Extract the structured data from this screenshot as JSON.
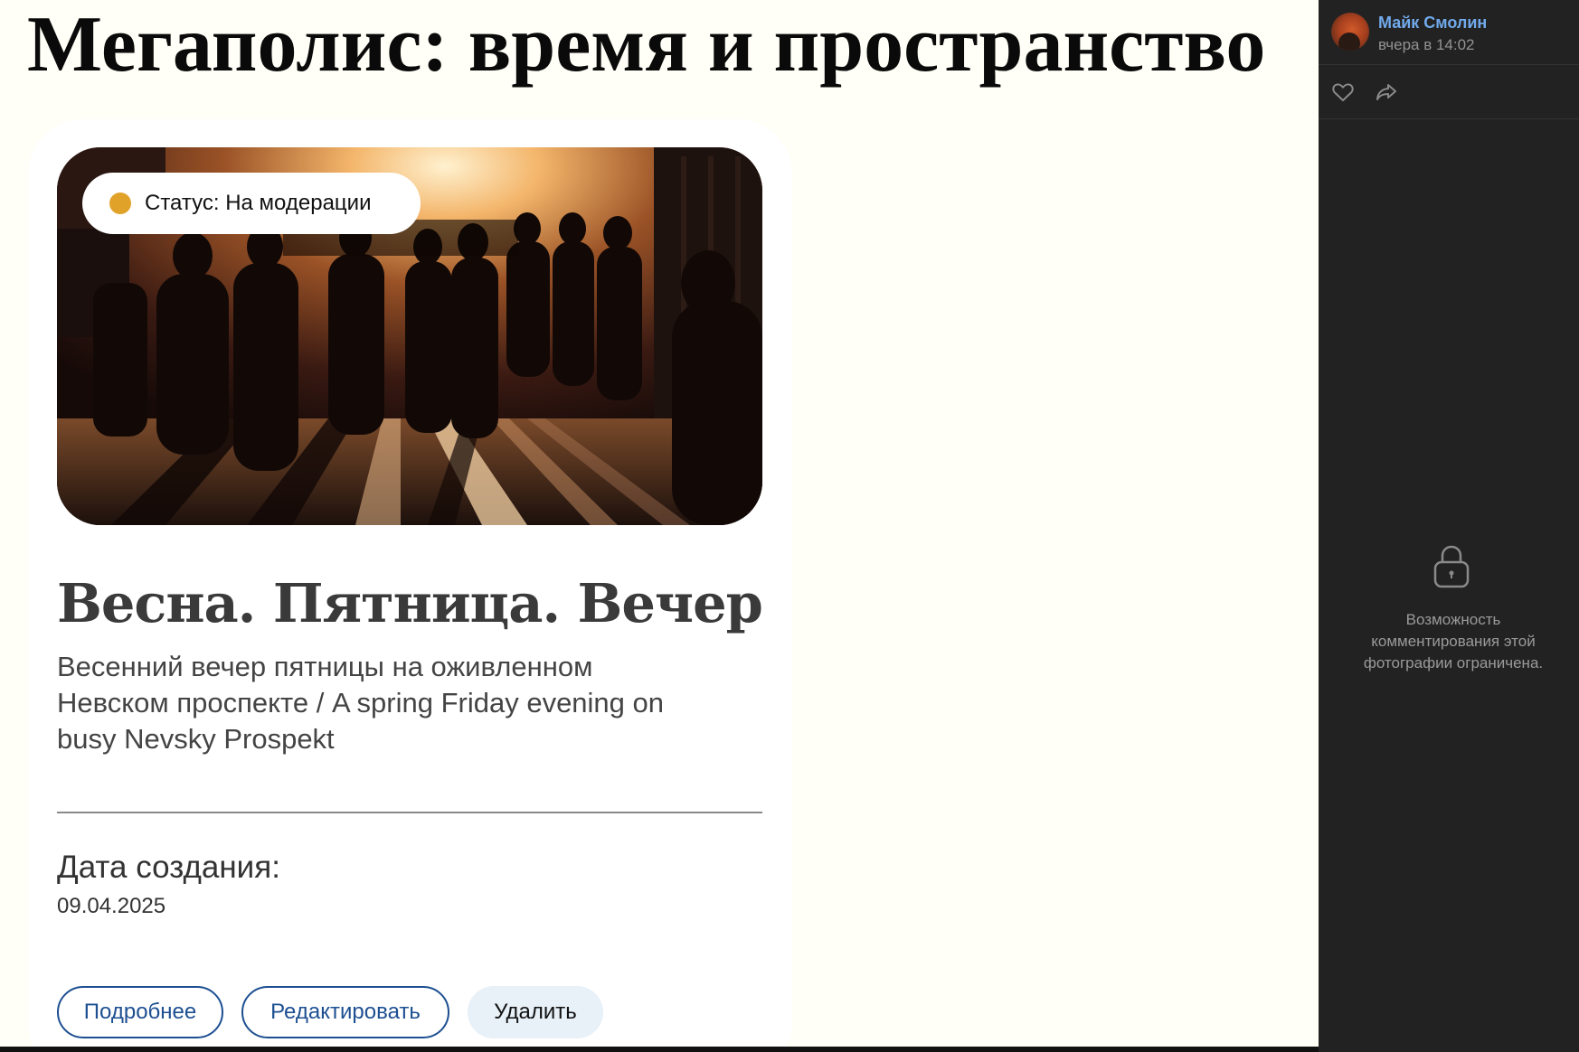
{
  "page": {
    "title": "Мегаполис: время и пространство"
  },
  "card": {
    "status_label": "Статус: На модерации",
    "status_color": "#e0a229",
    "title": "Весна. Пятница. Вечер",
    "description_lines": [
      "Весенний вечер пятницы на оживленном",
      "Невском проспекте / A spring Friday evening on",
      "busy Nevsky Prospekt"
    ],
    "date_label": "Дата создания:",
    "date_value": "09.04.2025",
    "buttons": {
      "more": "Подробнее",
      "edit": "Редактировать",
      "delete": "Удалить"
    }
  },
  "sidebar": {
    "author_name": "Майк Смолин",
    "post_time": "вчера в 14:02",
    "actions": [
      "heart-icon",
      "share-icon"
    ],
    "restriction_lines": [
      "Возможность",
      "комментирования этой",
      "фотографии ограничена."
    ],
    "accent_color": "#71aaeb"
  }
}
